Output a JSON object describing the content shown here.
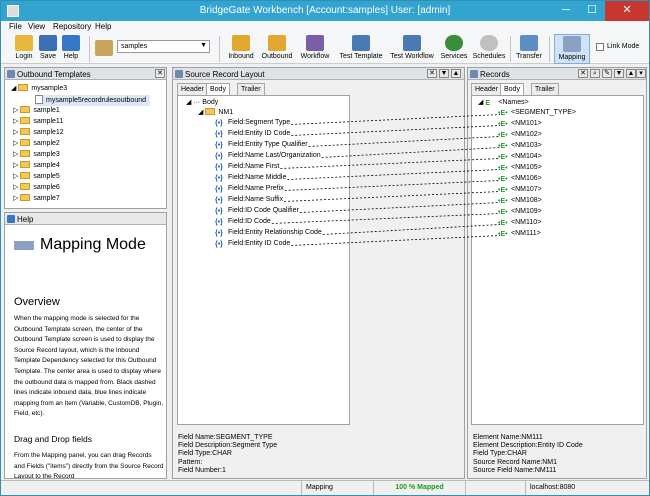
{
  "window": {
    "title": "BridgeGate Workbench [Account:samples] User: [admin]",
    "minimize": "─",
    "maximize": "☐",
    "close": "✕"
  },
  "menu": [
    "File",
    "View",
    "Repository",
    "Help"
  ],
  "toolbar": {
    "login": "Login",
    "save": "Save",
    "help": "Help",
    "account": "samples",
    "inbound": "Inbound",
    "outbound": "Outbound",
    "workflow": "Workflow",
    "test_template": "Test Template",
    "test_workflow": "Test Workflow",
    "services": "Services",
    "schedules": "Schedules",
    "transfer": "Transfer",
    "mapping": "Mapping",
    "link_mode": "Link Mode"
  },
  "outbound_panel": {
    "title": "Outbound Templates",
    "items": [
      "mysample3",
      "mysample5recordrulesoutbound",
      "sample1",
      "sample11",
      "sample12",
      "sample2",
      "sample3",
      "sample4",
      "sample5",
      "sample6",
      "sample7"
    ]
  },
  "help_panel": {
    "title": "Help",
    "heading": "Mapping Mode",
    "overview": "Overview",
    "overview_text": "When the mapping mode is selected for the Outbound Template screen, the center of the Outbound Template screen is used to display the Source Record layout, which is the Inbound Template Dependency selected for this Outbound Template. The center area is used to display where the outbound data is mapped from. Black dashed lines indicate inbound data, blue lines indicate mapping from an Item (Variable, CustomDB, Plugin, Field, etc).",
    "dnd_heading": "Drag and Drop fields",
    "dnd_text": "From the Mapping panel, you can drag Records and Fields (\"items\") directly from the Source Record Layout to the Record"
  },
  "source_panel": {
    "title": "Source Record Layout",
    "tabs": [
      "Header",
      "Body",
      "Trailer"
    ],
    "root": "Body",
    "record": "NM1",
    "fields": [
      "Field:Segment Type",
      "Field:Entity ID Code",
      "Field:Entity Type Qualifier",
      "Field:Name Last/Organization",
      "Field:Name First",
      "Field:Name Middle",
      "Field:Name Prefix",
      "Field:Name Suffix",
      "Field:ID Code Qualifier",
      "Field:ID Code",
      "Field:Entity Relationship Code",
      "Field:Entity ID Code"
    ],
    "details": [
      "Field Name:SEGMENT_TYPE",
      "Field Description:Segment Type",
      "Field Type:CHAR",
      "Pattern:",
      "Field Number:1"
    ]
  },
  "records_panel": {
    "title": "Records",
    "tabs": [
      "Header",
      "Body",
      "Trailer"
    ],
    "root": "<Names>",
    "items": [
      "<SEGMENT_TYPE>",
      "<NM101>",
      "<NM102>",
      "<NM103>",
      "<NM104>",
      "<NM105>",
      "<NM106>",
      "<NM107>",
      "<NM108>",
      "<NM109>",
      "<NM110>",
      "<NM111>"
    ],
    "details": [
      "Element Name:NM111",
      "Element Description:Entity ID Code",
      "Field Type:CHAR",
      "Source Record Name:NM1",
      "Source Field Name:NM111"
    ]
  },
  "status": {
    "mode": "Mapping",
    "mapped": "100 %  Mapped",
    "host": "localhost:8080"
  },
  "colors": {
    "titlebar": "#33a3cf",
    "close": "#c7372f",
    "mapped": "#1a9a1a"
  }
}
